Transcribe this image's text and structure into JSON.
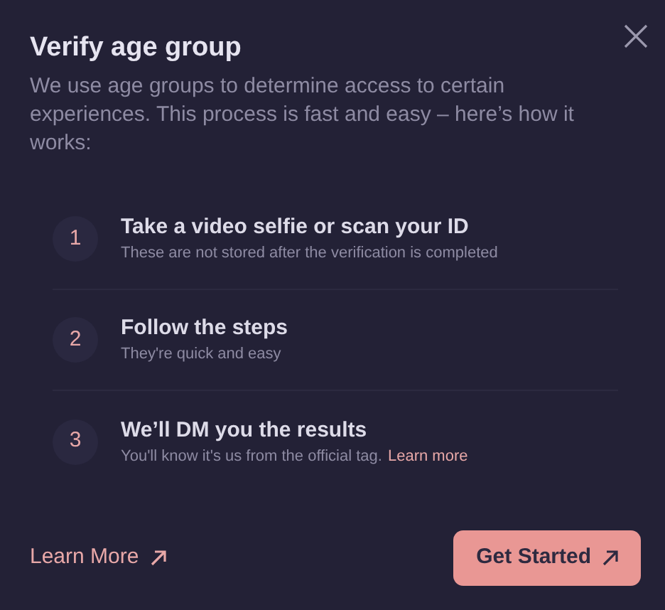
{
  "dialog": {
    "title": "Verify age group",
    "description": "We use age groups to determine access to certain experiences. This process is fast and easy – here’s how it works:",
    "steps": [
      {
        "number": "1",
        "title": "Take a video selfie or scan your ID",
        "subtitle": "These are not stored after the verification is completed"
      },
      {
        "number": "2",
        "title": "Follow the steps",
        "subtitle": "They're quick and easy"
      },
      {
        "number": "3",
        "title": "We’ll DM you the results",
        "subtitle": "You'll know it's us from the official tag.",
        "link": "Learn more"
      }
    ],
    "secondary_button": "Learn More",
    "primary_button": "Get Started"
  }
}
